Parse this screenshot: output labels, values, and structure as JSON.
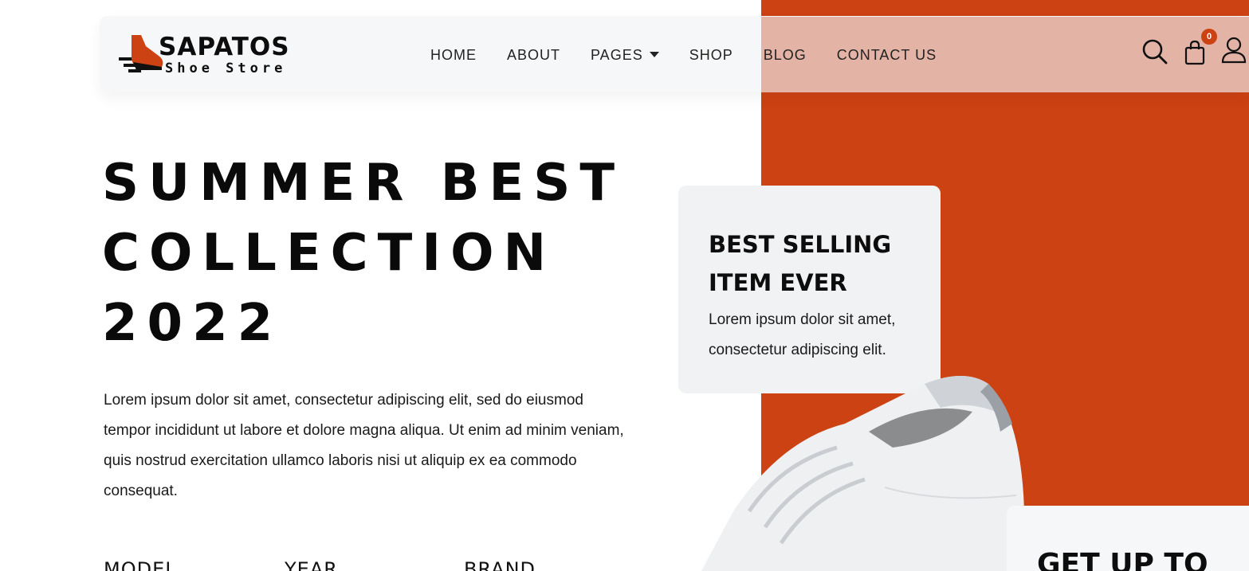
{
  "brand": {
    "name": "SAPATOS",
    "tagline": "Shoe Store"
  },
  "nav": {
    "items": [
      {
        "label": "HOME"
      },
      {
        "label": "ABOUT"
      },
      {
        "label": "PAGES"
      },
      {
        "label": "SHOP"
      },
      {
        "label": "BLOG"
      },
      {
        "label": "CONTACT US"
      }
    ]
  },
  "header_actions": {
    "cart_count": "0",
    "icons": [
      "search-icon",
      "cart-icon",
      "user-icon"
    ]
  },
  "hero": {
    "title": "SUMMER BEST COLLECTION 2022",
    "description": "Lorem ipsum dolor sit amet, consectetur adipiscing elit, sed do eiusmod tempor incididunt ut labore et dolore magna aliqua. Ut enim ad minim veniam, quis nostrud exercitation ullamco laboris nisi ut aliquip ex ea commodo consequat.",
    "stats": [
      "MODEL",
      "YEAR",
      "BRAND"
    ]
  },
  "best_selling": {
    "title": "BEST SELLING ITEM EVER",
    "text": "Lorem ipsum dolor sit amet, consectetur adipiscing elit."
  },
  "promo": {
    "title": "GET UP TO"
  },
  "colors": {
    "accent": "#cc4212",
    "header_bg": "#f6f7f8",
    "card_bg": "#f1f2f4",
    "text": "#111111"
  }
}
